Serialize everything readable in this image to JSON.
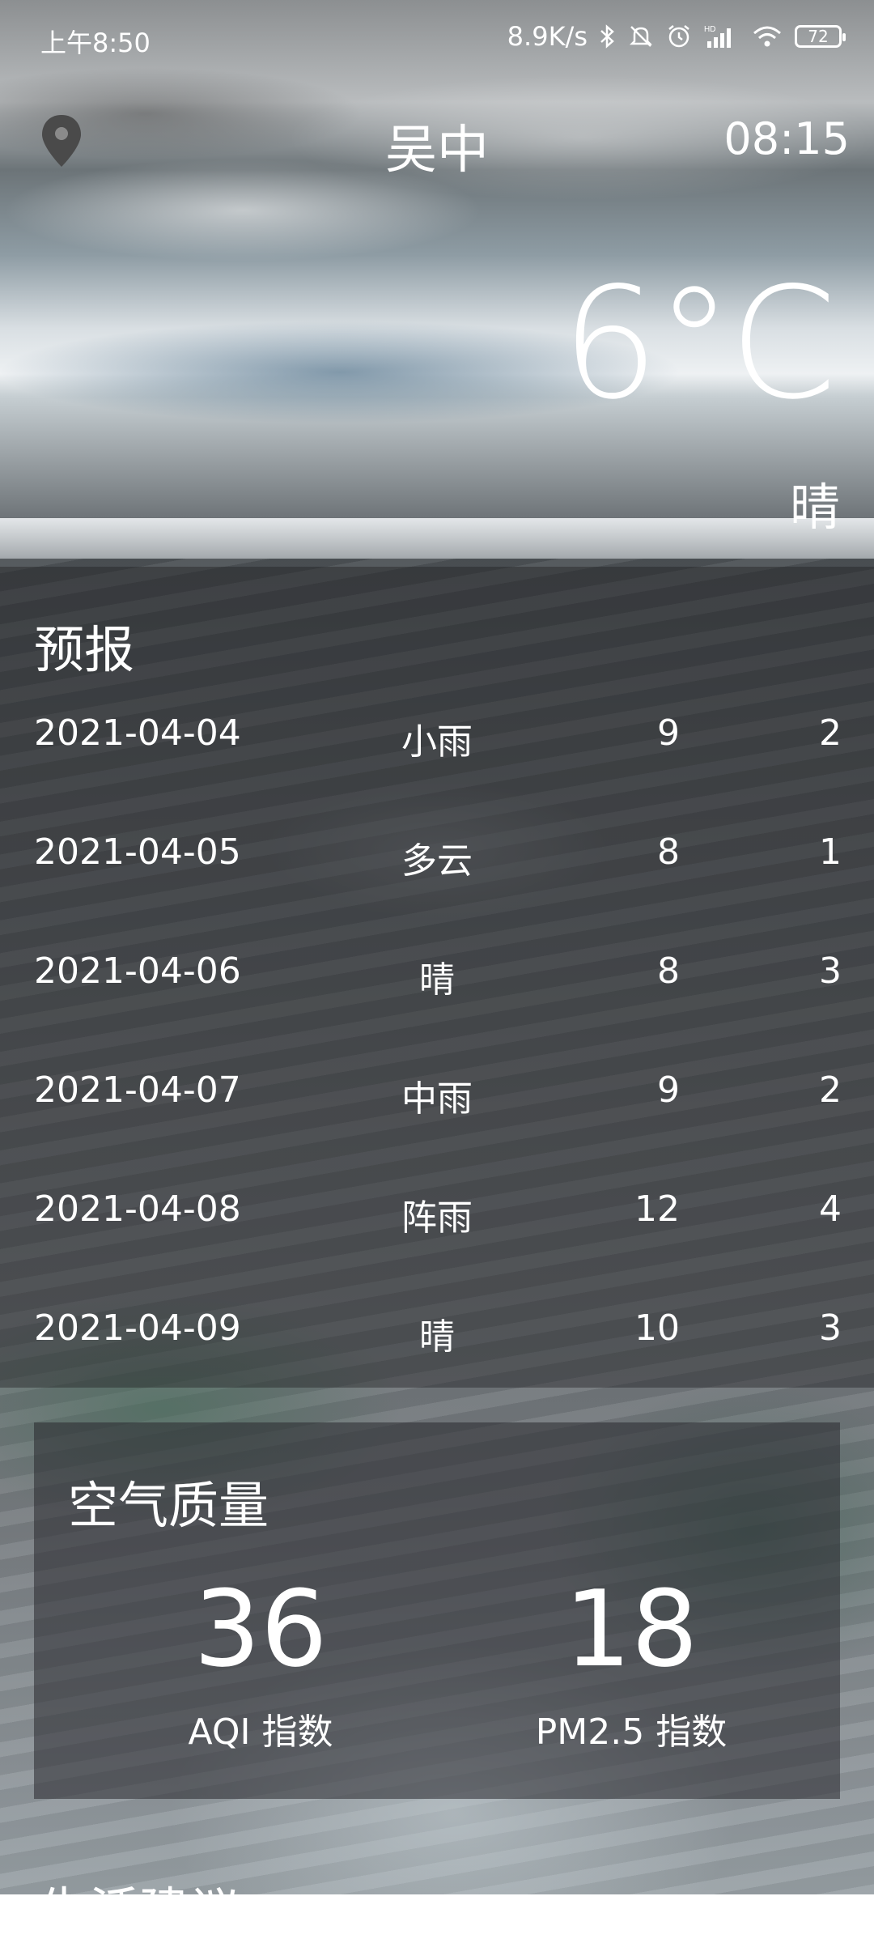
{
  "status_bar": {
    "time": "上午8:50",
    "net_speed": "8.9K/s",
    "battery": "72",
    "signal_label": "HD"
  },
  "header": {
    "city": "吴中",
    "update_time": "08:15",
    "temperature": "6°C",
    "condition": "晴"
  },
  "forecast": {
    "title": "预报",
    "rows": [
      {
        "date": "2021-04-04",
        "cond": "小雨",
        "max": "9",
        "min": "2"
      },
      {
        "date": "2021-04-05",
        "cond": "多云",
        "max": "8",
        "min": "1"
      },
      {
        "date": "2021-04-06",
        "cond": "晴",
        "max": "8",
        "min": "3"
      },
      {
        "date": "2021-04-07",
        "cond": "中雨",
        "max": "9",
        "min": "2"
      },
      {
        "date": "2021-04-08",
        "cond": "阵雨",
        "max": "12",
        "min": "4"
      },
      {
        "date": "2021-04-09",
        "cond": "晴",
        "max": "10",
        "min": "3"
      }
    ]
  },
  "air_quality": {
    "title": "空气质量",
    "aqi_value": "36",
    "aqi_label": "AQI 指数",
    "pm25_value": "18",
    "pm25_label": "PM2.5 指数"
  },
  "life": {
    "title": "生活建议"
  }
}
